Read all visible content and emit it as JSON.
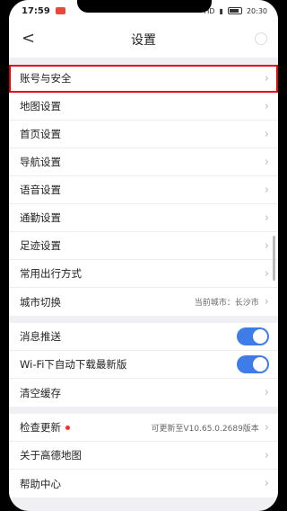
{
  "statusbar": {
    "time": "17:59",
    "signal_text": "HD",
    "clock_right": "20:30"
  },
  "navbar": {
    "title": "设置"
  },
  "group1": [
    {
      "label": "账号与安全"
    },
    {
      "label": "地图设置"
    },
    {
      "label": "首页设置"
    },
    {
      "label": "导航设置"
    },
    {
      "label": "语音设置"
    },
    {
      "label": "通勤设置"
    },
    {
      "label": "足迹设置"
    },
    {
      "label": "常用出行方式"
    },
    {
      "label": "城市切换",
      "value": "当前城市：长沙市"
    }
  ],
  "group2": [
    {
      "label": "消息推送",
      "toggle": "on"
    },
    {
      "label": "Wi-Fi下自动下载最新版",
      "toggle": "on"
    },
    {
      "label": "清空缓存"
    }
  ],
  "group3": [
    {
      "label": "检查更新",
      "value": "可更新至V10.65.0.2689版本"
    },
    {
      "label": "关于高德地图"
    },
    {
      "label": "帮助中心"
    }
  ],
  "colors": {
    "accent": "#3e7ce8",
    "highlight": "#e60012"
  }
}
